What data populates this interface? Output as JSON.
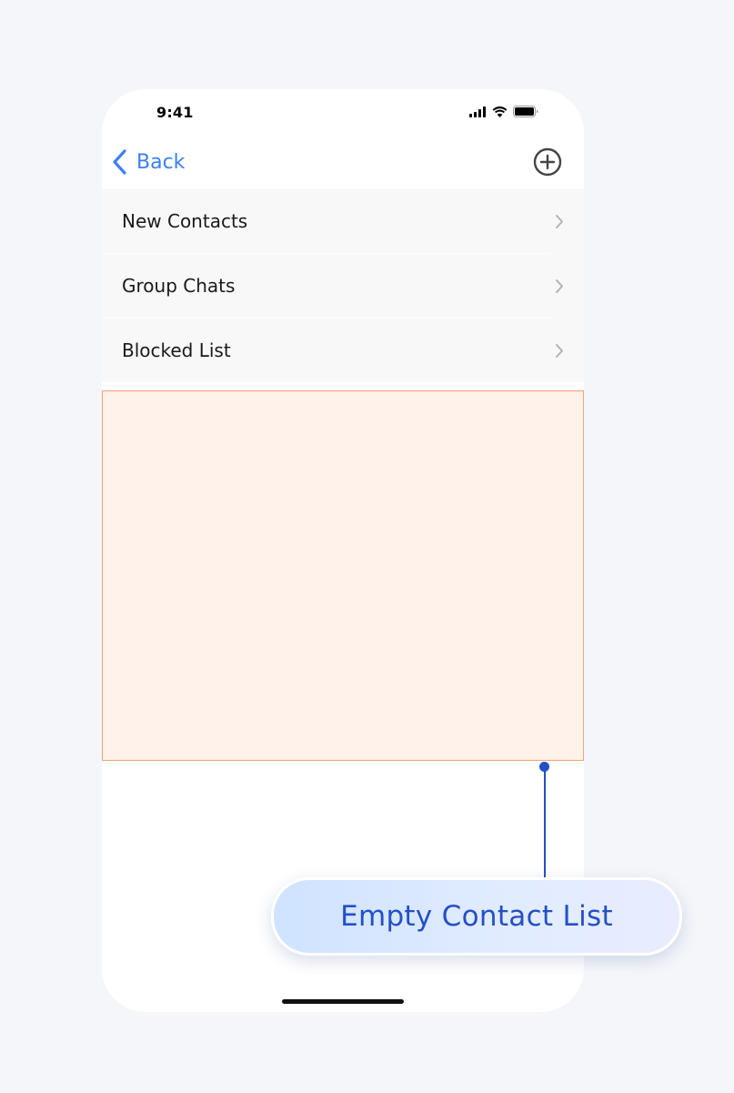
{
  "status_bar": {
    "time": "9:41",
    "icons": [
      "cellular-signal-icon",
      "wifi-icon",
      "battery-icon"
    ]
  },
  "nav_bar": {
    "back_label": "Back",
    "back_icon": "chevron-left-icon",
    "add_icon": "plus-circle-icon"
  },
  "menu": {
    "items": [
      {
        "label": "New Contacts",
        "icon": "chevron-right-icon"
      },
      {
        "label": "Group Chats",
        "icon": "chevron-right-icon"
      },
      {
        "label": "Blocked List",
        "icon": "chevron-right-icon"
      }
    ]
  },
  "annotation": {
    "label": "Empty Contact List"
  },
  "colors": {
    "page_background": "#f4f6fa",
    "accent_blue": "#3d7ff2",
    "annotation_blue": "#2450c6",
    "empty_area_fill": "#fff2ea",
    "empty_area_border": "#f4a474",
    "menu_background": "#f8f8f8"
  }
}
